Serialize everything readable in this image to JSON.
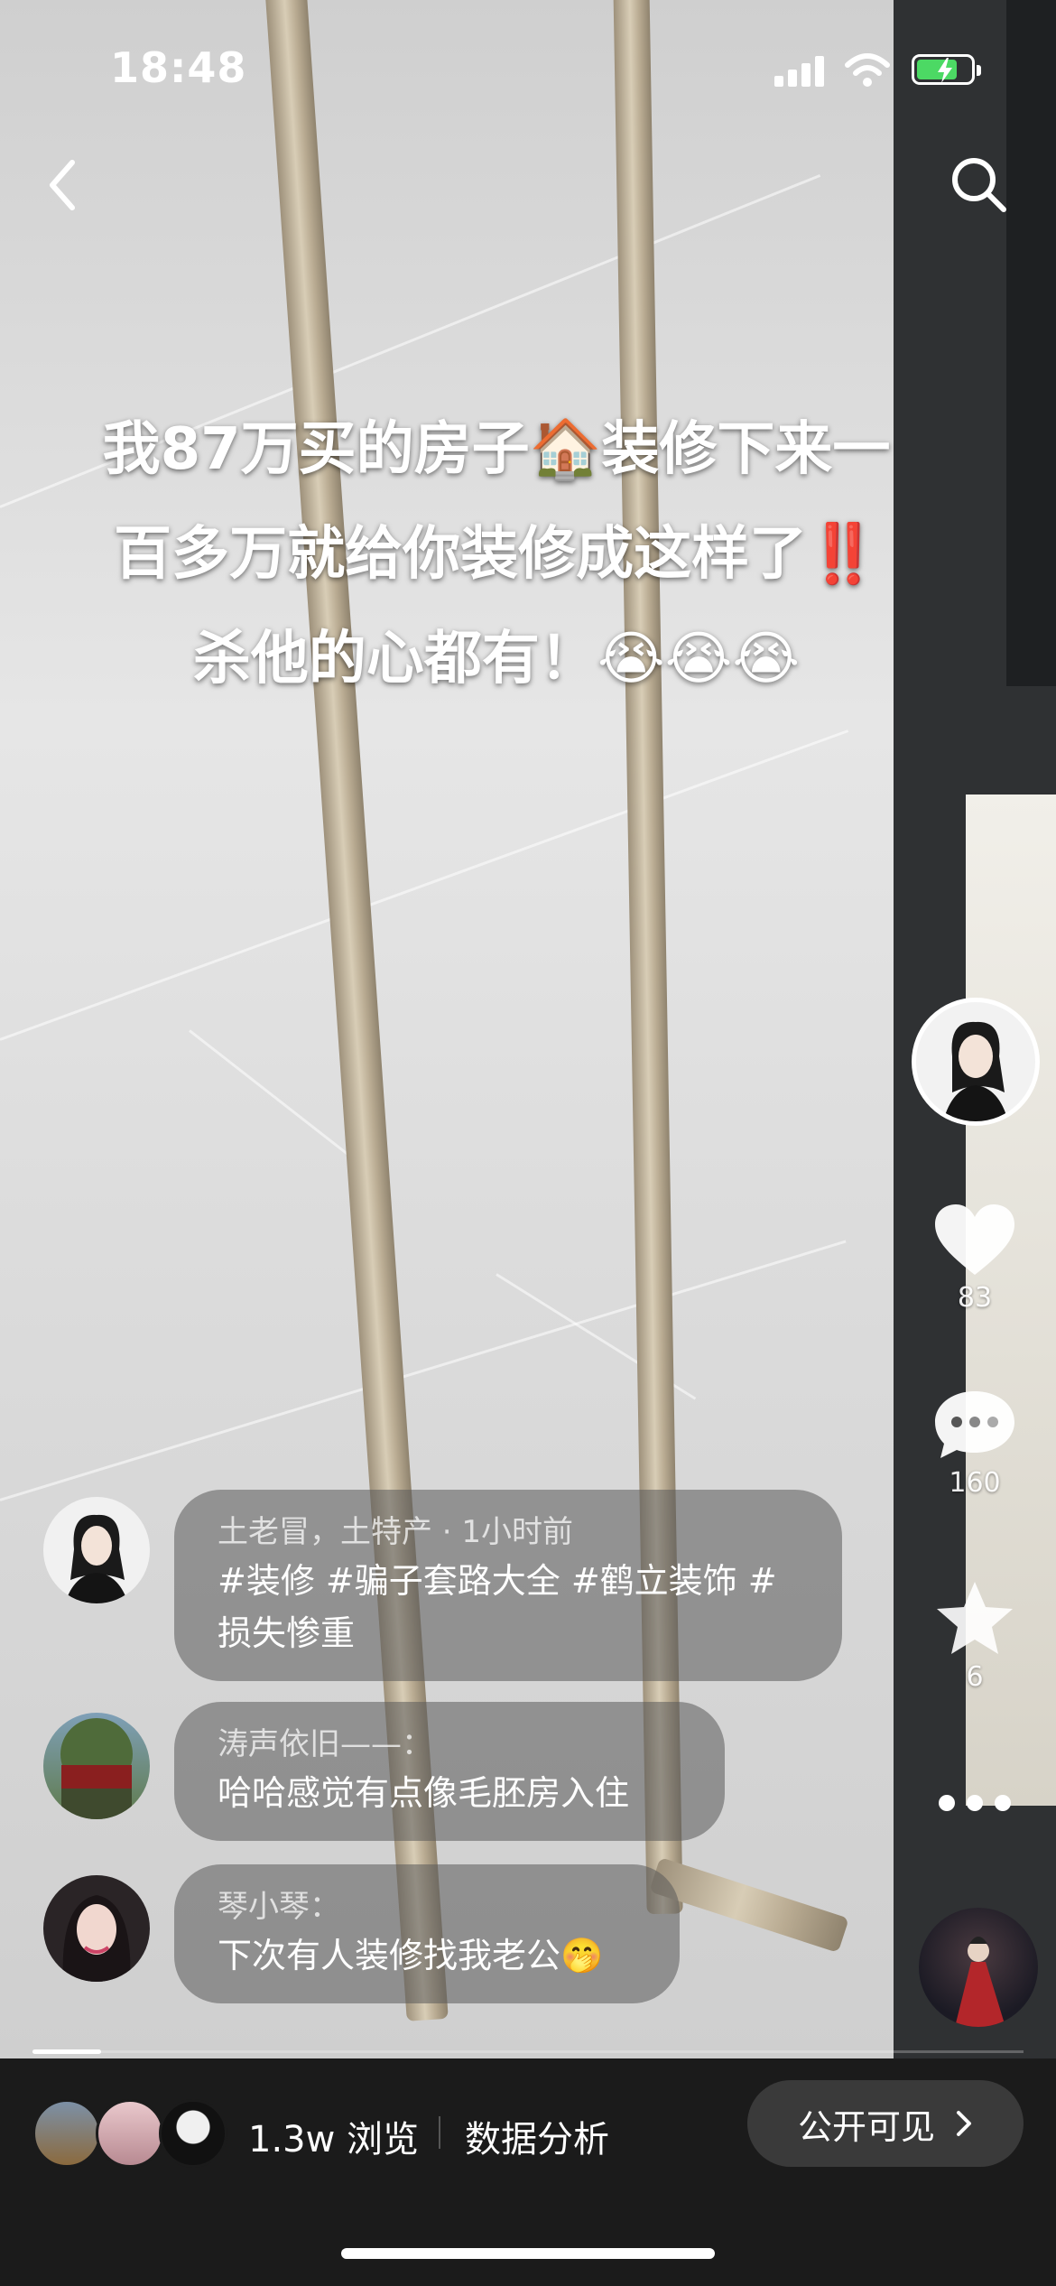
{
  "status_bar": {
    "time": "18:48"
  },
  "caption": {
    "lines": [
      "我87万买的房子🏠装修下来一",
      "百多万就给你装修成这样了‼️",
      "杀他的心都有！😭😭😭"
    ]
  },
  "actions": {
    "like_count": "83",
    "comment_count": "160",
    "favorite_count": "6"
  },
  "comments": [
    {
      "author": "土老冒，土特产 · 1小时前",
      "text": "#装修 #骗子套路大全  #鹤立装饰 #损失惨重"
    },
    {
      "author": "涛声依旧——：",
      "text": "哈哈感觉有点像毛胚房入住"
    },
    {
      "author": "琴小琴：",
      "text": "下次有人装修找我老公🤭"
    }
  ],
  "bottom_bar": {
    "views": "1.3w 浏览",
    "analysis": "数据分析",
    "visibility": "公开可见"
  },
  "icons": [
    "back-icon",
    "search-icon",
    "heart-icon",
    "comment-icon",
    "star-icon",
    "more-icon",
    "chevron-right-icon"
  ],
  "colors": {
    "bottom_bar": "#1b1b1b",
    "battery_charging": "#4cd964"
  }
}
